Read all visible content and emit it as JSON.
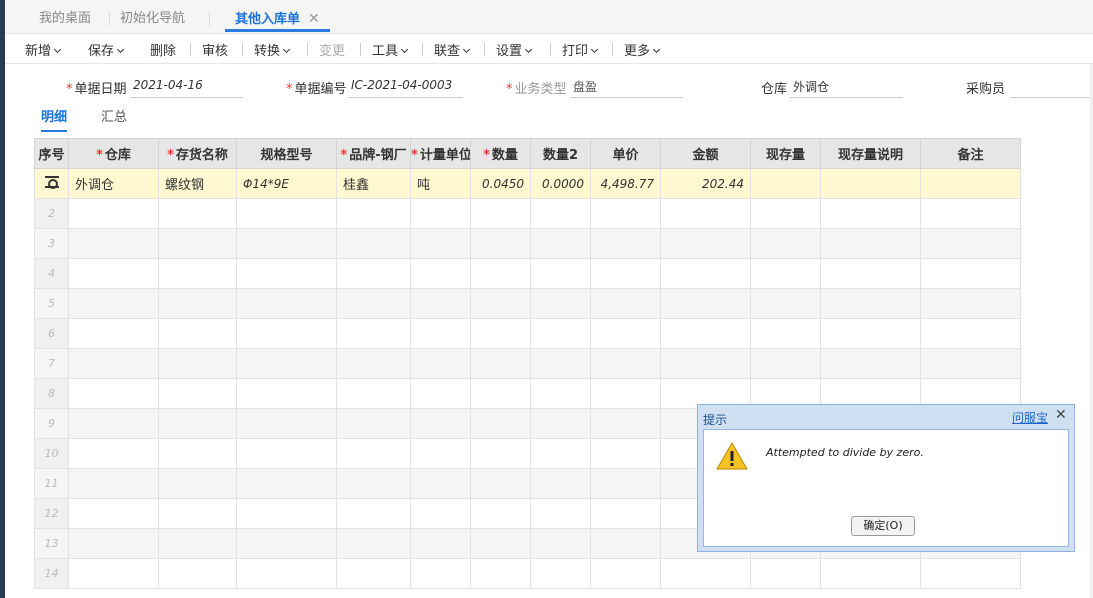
{
  "tabs": [
    {
      "label": "我的桌面"
    },
    {
      "label": "初始化导航"
    },
    {
      "label": "其他入库单",
      "close": "✕"
    }
  ],
  "toolbar": {
    "new": "新增",
    "save": "保存",
    "delete": "删除",
    "audit": "审核",
    "convert": "转换",
    "change": "变更",
    "tools": "工具",
    "link_query": "联查",
    "settings": "设置",
    "print": "打印",
    "more": "更多"
  },
  "form": {
    "date_label": "单据日期",
    "date_value": "2021-04-16",
    "code_label": "单据编号",
    "code_value": "IC-2021-04-0003",
    "biz_type_label": "业务类型",
    "biz_type_value": "盘盈",
    "warehouse_label": "仓库",
    "warehouse_value": "外调仓",
    "buyer_label": "采购员",
    "buyer_value": ""
  },
  "subtabs": {
    "detail": "明细",
    "summary": "汇总"
  },
  "grid": {
    "headers": [
      "序号",
      "仓库",
      "存货名称",
      "规格型号",
      "品牌-钢厂",
      "计量单位",
      "数量",
      "数量2",
      "单价",
      "金额",
      "现存量",
      "现存量说明",
      "备注"
    ],
    "rows": [
      {
        "idx": "",
        "warehouse": "外调仓",
        "item": "螺纹钢",
        "spec": "Φ14*9E",
        "brand": "桂鑫",
        "unit": "吨",
        "qty": "0.0450",
        "qty2": "0.0000",
        "price": "4,498.77",
        "amount": "202.44",
        "stock": "",
        "stock_note": "",
        "remark": ""
      },
      {
        "idx": "2"
      },
      {
        "idx": "3"
      },
      {
        "idx": "4"
      },
      {
        "idx": "5"
      },
      {
        "idx": "6"
      },
      {
        "idx": "7"
      },
      {
        "idx": "8"
      },
      {
        "idx": "9"
      },
      {
        "idx": "10"
      },
      {
        "idx": "11"
      },
      {
        "idx": "12"
      },
      {
        "idx": "13"
      },
      {
        "idx": "14"
      }
    ]
  },
  "dialog": {
    "title": "提示",
    "help": "问服宝",
    "close": "✕",
    "message": "Attempted to divide by zero.",
    "ok": "确定(O)"
  },
  "colors": {
    "accent": "#2b7be0",
    "selected_row": "#fff8d0",
    "required": "#ee3333"
  }
}
